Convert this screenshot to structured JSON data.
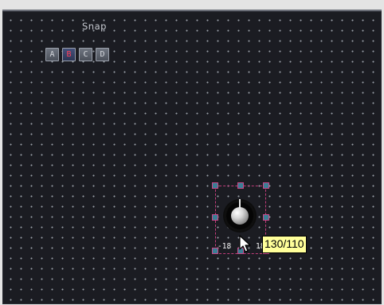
{
  "snap": {
    "label": "Snap",
    "buttons": [
      "A",
      "B",
      "C",
      "D"
    ],
    "selected": "B"
  },
  "knob": {
    "min_label": "-18",
    "max_label": "18",
    "tooltip": "130/110"
  },
  "colors": {
    "canvas_bg": "#1b1c22",
    "grid_dot": "#9a9fa8",
    "selection": "#c13c7a",
    "handle": "#3a7f95",
    "snap_active_text": "#ff3f5a",
    "tooltip_bg": "#ffff9a"
  },
  "icons": {
    "cursor": "arrow-cursor-icon"
  }
}
